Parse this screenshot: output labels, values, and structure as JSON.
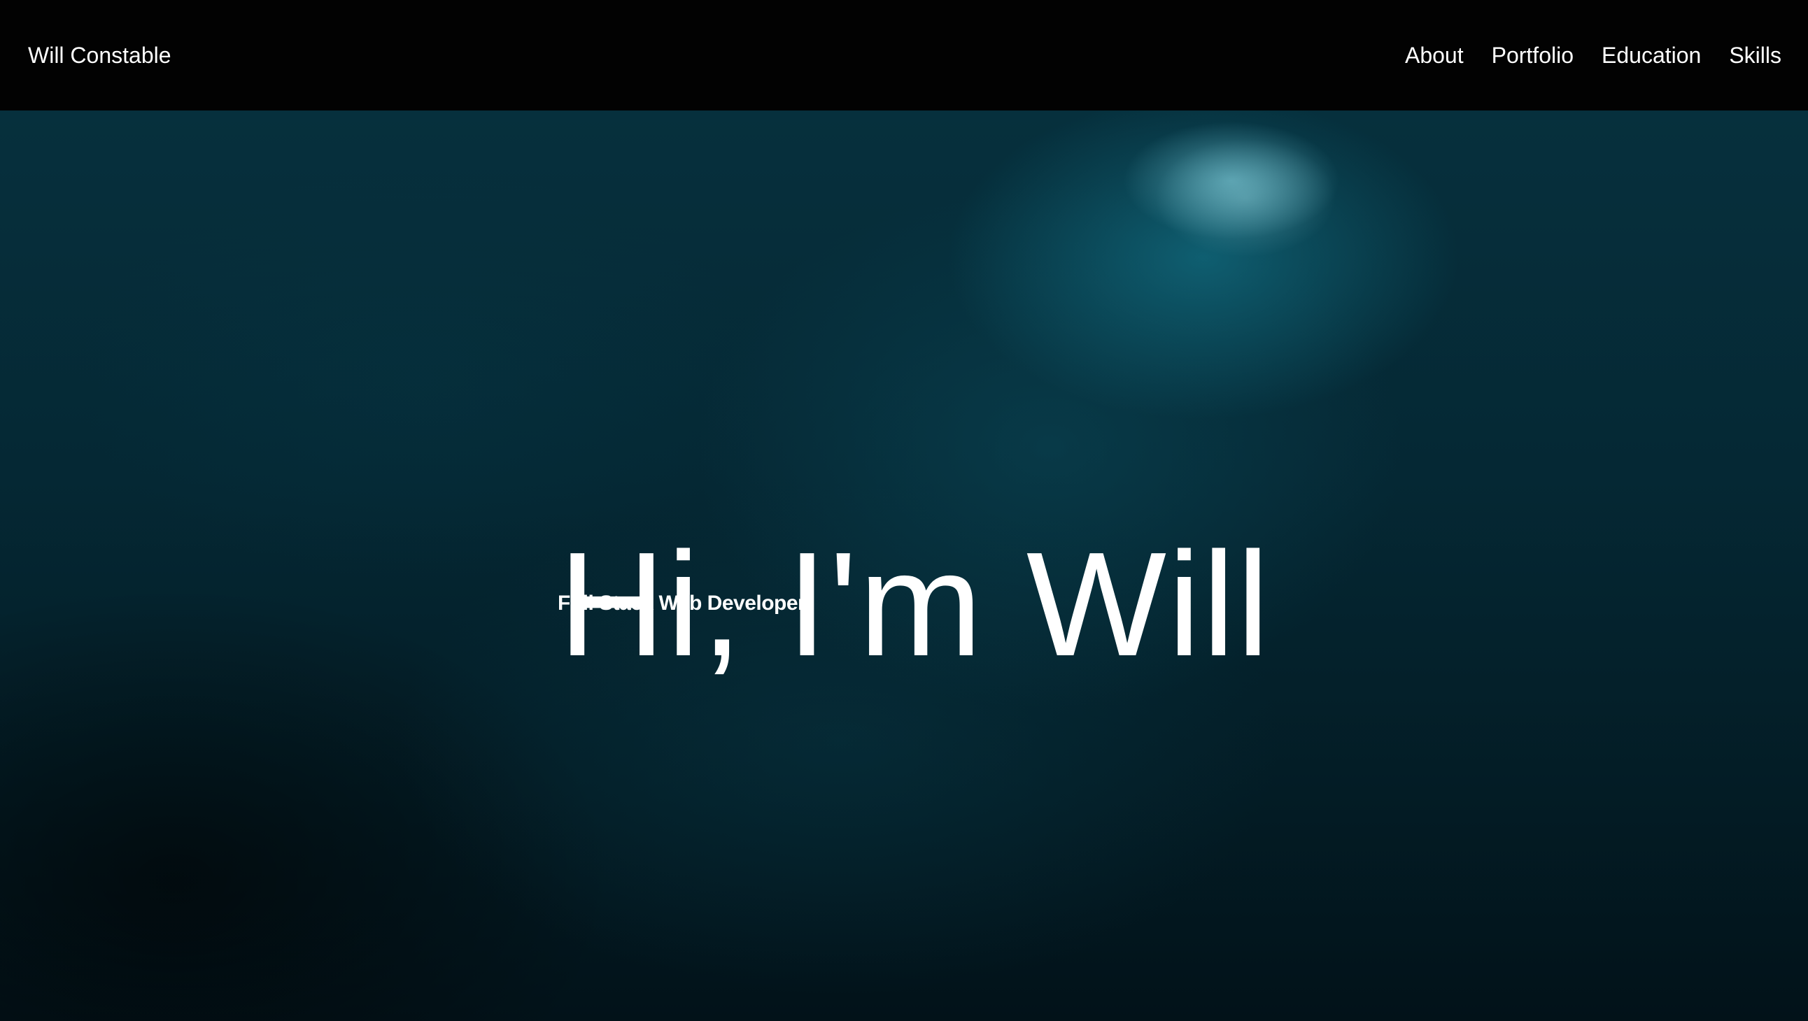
{
  "header": {
    "brand": "Will Constable",
    "nav": [
      {
        "label": "About"
      },
      {
        "label": "Portfolio"
      },
      {
        "label": "Education"
      },
      {
        "label": "Skills"
      }
    ]
  },
  "hero": {
    "title": "Hi, I'm Will",
    "subtitle": "Full Stack Web Developer",
    "background": "dark-teal-underwater-image"
  },
  "colors": {
    "header_bg": "#020202",
    "text": "#ffffff",
    "hero_bg": "#052834"
  }
}
